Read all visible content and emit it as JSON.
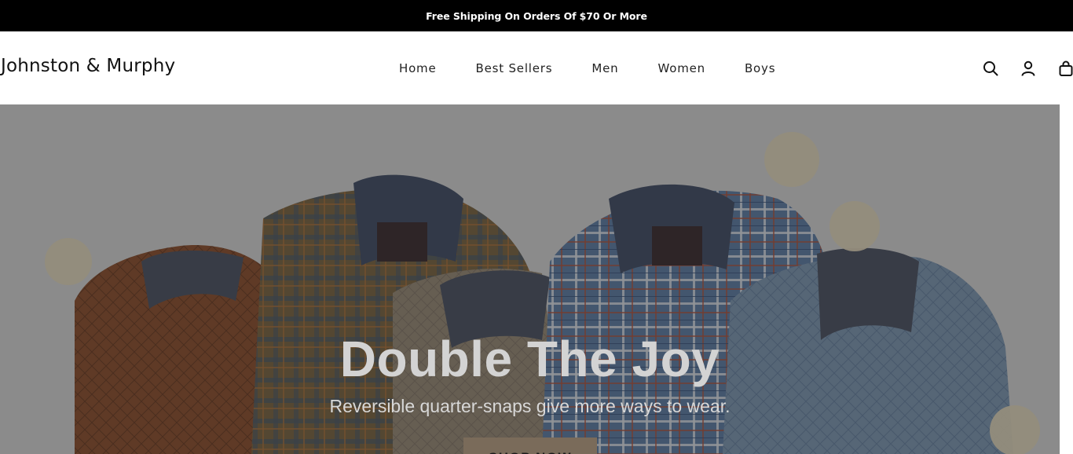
{
  "announcement": {
    "text": "Free Shipping On Orders Of $70 Or More"
  },
  "header": {
    "logo": "Johnston & Murphy",
    "nav": [
      {
        "label": "Home"
      },
      {
        "label": "Best Sellers"
      },
      {
        "label": "Men"
      },
      {
        "label": "Women"
      },
      {
        "label": "Boys"
      }
    ],
    "icons": [
      "search-icon",
      "account-icon",
      "bag-icon"
    ]
  },
  "hero": {
    "title": "Double The Joy",
    "subtitle": "Reversible quarter-snaps give more ways to wear.",
    "cta_label": "SHOP NOW",
    "colors": {
      "overlay": "#5a5a5a",
      "cta": "#7a6b5a"
    }
  }
}
